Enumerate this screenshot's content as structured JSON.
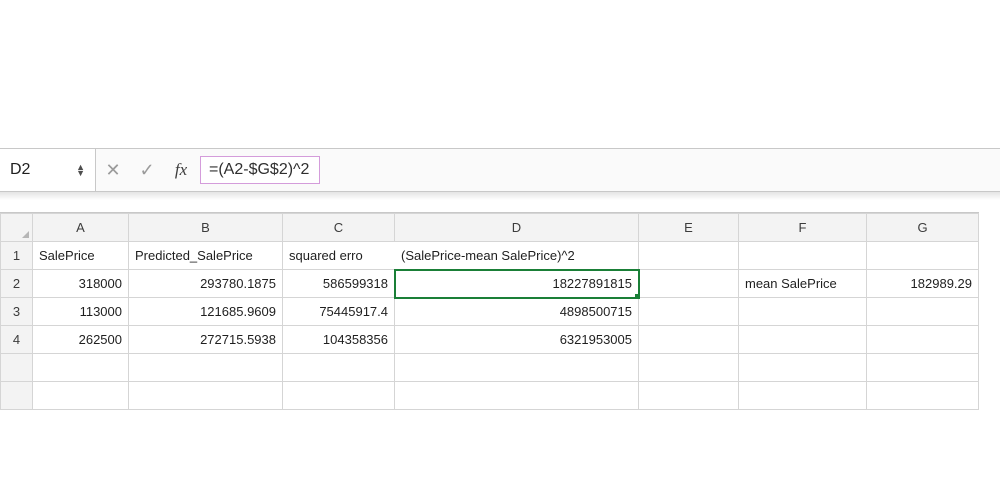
{
  "name_box": {
    "value": "D2"
  },
  "formula_bar": {
    "cancel_glyph": "✕",
    "confirm_glyph": "✓",
    "fx_label": "fx",
    "formula": "=(A2-$G$2)^2"
  },
  "columns": [
    "A",
    "B",
    "C",
    "D",
    "E",
    "F",
    "G"
  ],
  "rows": {
    "1": {
      "A": "SalePrice",
      "B": "Predicted_SalePrice",
      "C": "squared erro",
      "D": "(SalePrice-mean SalePrice)^2",
      "E": "",
      "F": "",
      "G": ""
    },
    "2": {
      "A": "318000",
      "B": "293780.1875",
      "C": "586599318",
      "D": "18227891815",
      "E": "",
      "F": "mean SalePrice",
      "G": "182989.29"
    },
    "3": {
      "A": "113000",
      "B": "121685.9609",
      "C": "75445917.4",
      "D": "4898500715",
      "E": "",
      "F": "",
      "G": ""
    },
    "4": {
      "A": "262500",
      "B": "272715.5938",
      "C": "104358356",
      "D": "6321953005",
      "E": "",
      "F": "",
      "G": ""
    }
  },
  "active_cell": "D2",
  "chart_data": {
    "type": "table",
    "title": "",
    "columns": [
      "SalePrice",
      "Predicted_SalePrice",
      "squared error",
      "(SalePrice-mean SalePrice)^2"
    ],
    "records": [
      {
        "SalePrice": 318000,
        "Predicted_SalePrice": 293780.1875,
        "squared error": 586599318,
        "(SalePrice-mean SalePrice)^2": 18227891815
      },
      {
        "SalePrice": 113000,
        "Predicted_SalePrice": 121685.9609,
        "squared error": 75445917.4,
        "(SalePrice-mean SalePrice)^2": 4898500715
      },
      {
        "SalePrice": 262500,
        "Predicted_SalePrice": 272715.5938,
        "squared error": 104358356,
        "(SalePrice-mean SalePrice)^2": 6321953005
      }
    ],
    "aux": {
      "mean SalePrice": 182989.29
    },
    "formula_D2": "=(A2-$G$2)^2"
  }
}
